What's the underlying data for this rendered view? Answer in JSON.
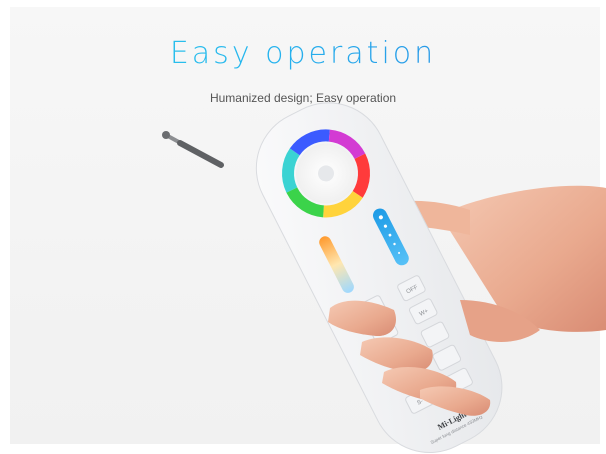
{
  "headline": "Easy operation",
  "subline": "Humanized design; Easy operation",
  "remote": {
    "buttons_right": [
      "OFF",
      "W+",
      "W-",
      "M",
      "ON",
      "S-"
    ],
    "logo": "Mi·Light",
    "logo_sub": "Super long distance 433MHz"
  },
  "colors": {
    "accent_cyan": "#2fd3e8",
    "accent_blue": "#2c7fe0",
    "remote_body": "#f6f7f9",
    "slider_blue": "#1d9be6"
  }
}
